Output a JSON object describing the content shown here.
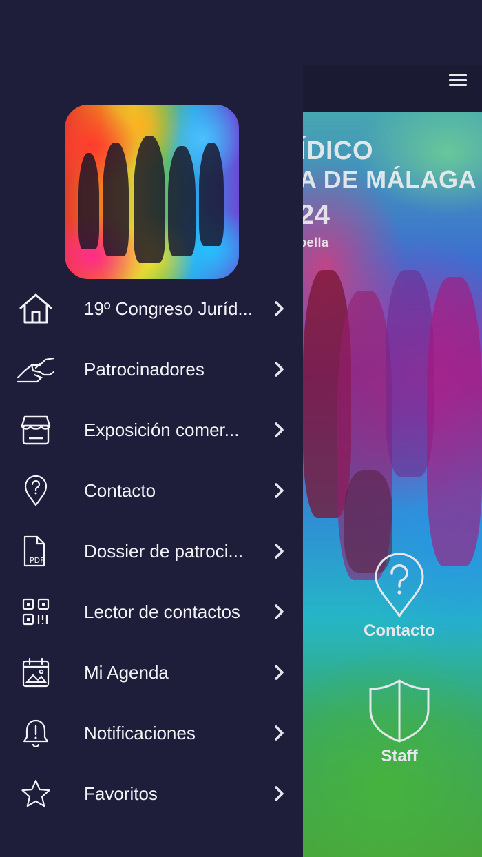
{
  "main": {
    "hero": {
      "title_line1": "ÍDICO",
      "title_line2": "A DE MÁLAGA",
      "title_line3": "24",
      "title_line4": "bella"
    },
    "shortcuts": [
      {
        "label": "Contacto",
        "icon": "question-pin-icon"
      },
      {
        "label": "Staff",
        "icon": "shield-icon"
      }
    ],
    "menu_icon": "hamburger-icon"
  },
  "drawer": {
    "items": [
      {
        "label": "19º Congreso Juríd...",
        "icon": "home-icon"
      },
      {
        "label": "Patrocinadores",
        "icon": "handshake-icon"
      },
      {
        "label": "Exposición comer...",
        "icon": "store-icon"
      },
      {
        "label": "Contacto",
        "icon": "question-pin-icon"
      },
      {
        "label": "Dossier de patroci...",
        "icon": "pdf-file-icon"
      },
      {
        "label": "Lector de contactos",
        "icon": "qr-code-icon"
      },
      {
        "label": "Mi Agenda",
        "icon": "calendar-icon"
      },
      {
        "label": "Notificaciones",
        "icon": "bell-icon"
      },
      {
        "label": "Favoritos",
        "icon": "star-icon"
      }
    ]
  },
  "colors": {
    "background": "#1e1d3a",
    "header": "#1b1a33",
    "text": "#f2f2f7"
  }
}
